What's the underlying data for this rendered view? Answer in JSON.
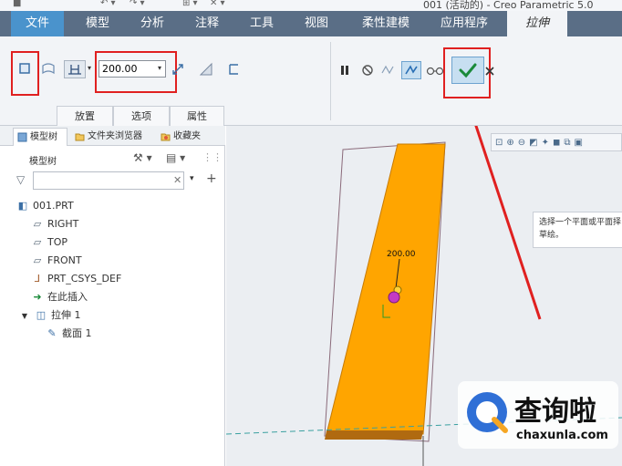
{
  "window": {
    "title": "001 (活动的) - Creo Parametric 5.0"
  },
  "menu": {
    "tabs": [
      "文件",
      "模型",
      "分析",
      "注释",
      "工具",
      "视图",
      "柔性建模",
      "应用程序",
      "拉伸"
    ]
  },
  "ribbon": {
    "depth_value": "200.00",
    "subtabs": [
      "放置",
      "选项",
      "属性"
    ]
  },
  "panel": {
    "tabs": [
      "模型树",
      "文件夹浏览器",
      "收藏夹"
    ],
    "model_tree_label": "模型树",
    "filter_placeholder": "",
    "tree": [
      {
        "label": "001.PRT",
        "icon": "part-icon"
      },
      {
        "label": "RIGHT",
        "icon": "datum-plane-icon"
      },
      {
        "label": "TOP",
        "icon": "datum-plane-icon"
      },
      {
        "label": "FRONT",
        "icon": "datum-plane-icon"
      },
      {
        "label": "PRT_CSYS_DEF",
        "icon": "csys-icon"
      },
      {
        "label": "在此插入",
        "icon": "insert-arrow-icon"
      },
      {
        "label": "拉伸 1",
        "icon": "extrude-icon"
      },
      {
        "label": "截面 1",
        "icon": "sketch-icon"
      }
    ]
  },
  "graphics": {
    "dimension_label": "200.00",
    "tooltip_text": "选择一个平面或平面择草绘。"
  },
  "watermark": {
    "brand": "查询啦",
    "domain": "chaxunla.com"
  },
  "colors": {
    "tab_bar": "#5a6e86",
    "file_tab": "#4a93cc",
    "highlight_red": "#e02020",
    "extrude_fill": "#ffa500",
    "ok_check": "#1a8a3a"
  }
}
